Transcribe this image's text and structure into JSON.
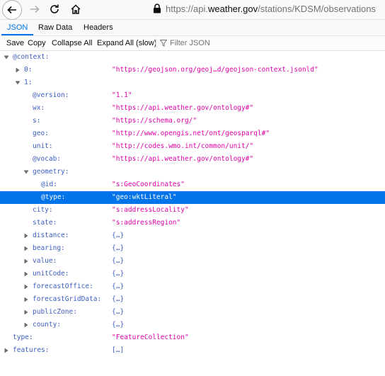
{
  "browser": {
    "url_prefix": "https://api.",
    "url_host": "weather.gov",
    "url_path": "/stations/KDSM/observations"
  },
  "tabs": [
    "JSON",
    "Raw Data",
    "Headers"
  ],
  "json_toolbar": {
    "save": "Save",
    "copy": "Copy",
    "collapse_all": "Collapse All",
    "expand_all": "Expand All (slow)",
    "filter_placeholder": "Filter JSON"
  },
  "tree": [
    {
      "key": "@context:",
      "value": "",
      "depth": 0,
      "twisty": "open"
    },
    {
      "key": "0:",
      "value": "\"https://geojson.org/geoj…d/geojson-context.jsonld\"",
      "depth": 1,
      "twisty": "closed",
      "kind": "str"
    },
    {
      "key": "1:",
      "value": "",
      "depth": 1,
      "twisty": "open"
    },
    {
      "key": "@version:",
      "value": "\"1.1\"",
      "depth": 2,
      "twisty": "none",
      "kind": "str"
    },
    {
      "key": "wx:",
      "value": "\"https://api.weather.gov/ontology#\"",
      "depth": 2,
      "twisty": "none",
      "kind": "str"
    },
    {
      "key": "s:",
      "value": "\"https://schema.org/\"",
      "depth": 2,
      "twisty": "none",
      "kind": "str"
    },
    {
      "key": "geo:",
      "value": "\"http://www.opengis.net/ont/geosparql#\"",
      "depth": 2,
      "twisty": "none",
      "kind": "str"
    },
    {
      "key": "unit:",
      "value": "\"http://codes.wmo.int/common/unit/\"",
      "depth": 2,
      "twisty": "none",
      "kind": "str"
    },
    {
      "key": "@vocab:",
      "value": "\"https://api.weather.gov/ontology#\"",
      "depth": 2,
      "twisty": "none",
      "kind": "str"
    },
    {
      "key": "geometry:",
      "value": "",
      "depth": 2,
      "twisty": "open"
    },
    {
      "key": "@id:",
      "value": "\"s:GeoCoordinates\"",
      "depth": 3,
      "twisty": "none",
      "kind": "str"
    },
    {
      "key": "@type:",
      "value": "\"geo:wktLiteral\"",
      "depth": 3,
      "twisty": "none",
      "kind": "str",
      "selected": true
    },
    {
      "key": "city:",
      "value": "\"s:addressLocality\"",
      "depth": 2,
      "twisty": "none",
      "kind": "str"
    },
    {
      "key": "state:",
      "value": "\"s:addressRegion\"",
      "depth": 2,
      "twisty": "none",
      "kind": "str"
    },
    {
      "key": "distance:",
      "value": "{…}",
      "depth": 2,
      "twisty": "closed",
      "kind": "obj"
    },
    {
      "key": "bearing:",
      "value": "{…}",
      "depth": 2,
      "twisty": "closed",
      "kind": "obj"
    },
    {
      "key": "value:",
      "value": "{…}",
      "depth": 2,
      "twisty": "closed",
      "kind": "obj"
    },
    {
      "key": "unitCode:",
      "value": "{…}",
      "depth": 2,
      "twisty": "closed",
      "kind": "obj"
    },
    {
      "key": "forecastOffice:",
      "value": "{…}",
      "depth": 2,
      "twisty": "closed",
      "kind": "obj"
    },
    {
      "key": "forecastGridData:",
      "value": "{…}",
      "depth": 2,
      "twisty": "closed",
      "kind": "obj"
    },
    {
      "key": "publicZone:",
      "value": "{…}",
      "depth": 2,
      "twisty": "closed",
      "kind": "obj"
    },
    {
      "key": "county:",
      "value": "{…}",
      "depth": 2,
      "twisty": "closed",
      "kind": "obj"
    },
    {
      "key": "type:",
      "value": "\"FeatureCollection\"",
      "depth": 0,
      "twisty": "none",
      "kind": "str"
    },
    {
      "key": "features:",
      "value": "[…]",
      "depth": 0,
      "twisty": "closed",
      "kind": "obj"
    }
  ]
}
